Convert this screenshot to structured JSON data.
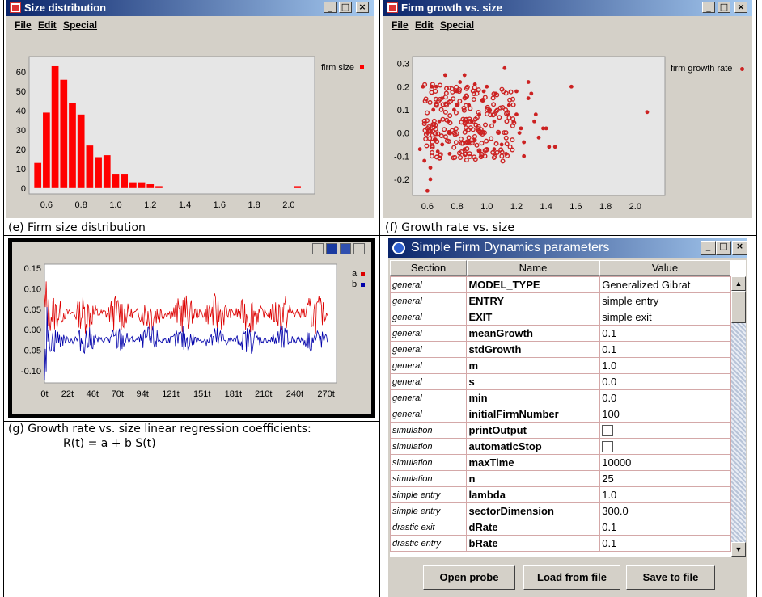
{
  "size_window": {
    "title": "Size distribution",
    "menu": [
      "File",
      "Edit",
      "Special"
    ],
    "legend": "firm size"
  },
  "growth_window": {
    "title": "Firm growth vs. size",
    "menu": [
      "File",
      "Edit",
      "Special"
    ],
    "legend": "firm growth rate"
  },
  "captions": {
    "e": "(e) Firm size distribution",
    "f": "(f) Growth rate vs. size",
    "g": "(g) Growth rate vs. size linear regression coefficients:",
    "g_formula": "R(t) = a + b S(t)"
  },
  "timeseries_legend": [
    "a",
    "b"
  ],
  "params_window": {
    "title": "Simple Firm Dynamics parameters",
    "headers": [
      "Section",
      "Name",
      "Value"
    ],
    "rows": [
      {
        "section": "general",
        "name": "MODEL_TYPE",
        "value": "Generalized Gibrat"
      },
      {
        "section": "general",
        "name": "ENTRY",
        "value": "simple entry"
      },
      {
        "section": "general",
        "name": "EXIT",
        "value": "simple exit"
      },
      {
        "section": "general",
        "name": "meanGrowth",
        "value": "0.1"
      },
      {
        "section": "general",
        "name": "stdGrowth",
        "value": "0.1"
      },
      {
        "section": "general",
        "name": "m",
        "value": "1.0"
      },
      {
        "section": "general",
        "name": "s",
        "value": "0.0"
      },
      {
        "section": "general",
        "name": "min",
        "value": "0.0"
      },
      {
        "section": "general",
        "name": "initialFirmNumber",
        "value": "100"
      },
      {
        "section": "simulation",
        "name": "printOutput",
        "value": ""
      },
      {
        "section": "simulation",
        "name": "automaticStop",
        "value": ""
      },
      {
        "section": "simulation",
        "name": "maxTime",
        "value": "10000"
      },
      {
        "section": "simulation",
        "name": "n",
        "value": "25"
      },
      {
        "section": "simple entry",
        "name": "lambda",
        "value": "1.0"
      },
      {
        "section": "simple entry",
        "name": "sectorDimension",
        "value": "300.0"
      },
      {
        "section": "drastic exit",
        "name": "dRate",
        "value": "0.1"
      },
      {
        "section": "drastic entry",
        "name": "bRate",
        "value": "0.1"
      }
    ],
    "buttons": [
      "Open probe",
      "Load from file",
      "Save to file"
    ]
  },
  "chart_data": [
    {
      "type": "bar",
      "x": [
        0.55,
        0.6,
        0.65,
        0.7,
        0.75,
        0.8,
        0.85,
        0.9,
        0.95,
        1.0,
        1.05,
        1.1,
        1.15,
        1.2,
        1.25,
        1.3,
        1.35,
        1.4,
        1.45,
        1.5,
        1.55,
        2.05
      ],
      "values": [
        13,
        39,
        63,
        56,
        44,
        38,
        22,
        16,
        17,
        7,
        7,
        3,
        3,
        2,
        1,
        0,
        0,
        0,
        0,
        0,
        0,
        1
      ],
      "xticks": [
        "0.6",
        "0.8",
        "1.0",
        "1.2",
        "1.4",
        "1.6",
        "1.8",
        "2.0"
      ],
      "yticks": [
        "0",
        "10",
        "20",
        "30",
        "40",
        "50",
        "60"
      ],
      "xlim": [
        0.5,
        2.15
      ],
      "ylim": [
        -3,
        68
      ],
      "legend": "firm size",
      "color": "#ff0000"
    },
    {
      "type": "scatter",
      "xticks": [
        "0.6",
        "0.8",
        "1.0",
        "1.2",
        "1.4",
        "1.6",
        "1.8",
        "2.0"
      ],
      "yticks": [
        "0.3",
        "0.2",
        "0.1",
        "0.0",
        "-0.1",
        "-0.2"
      ],
      "xlim": [
        0.5,
        2.2
      ],
      "ylim": [
        -0.27,
        0.33
      ],
      "legend": "firm growth rate",
      "color": "#cc2222",
      "points": [
        [
          0.6,
          -0.25
        ],
        [
          0.62,
          -0.2
        ],
        [
          0.58,
          -0.12
        ],
        [
          0.55,
          -0.07
        ],
        [
          0.63,
          0.2
        ],
        [
          0.57,
          0.2
        ],
        [
          0.66,
          0.2
        ],
        [
          0.7,
          0.15
        ],
        [
          0.72,
          0.25
        ],
        [
          0.68,
          0.05
        ],
        [
          0.7,
          -0.05
        ],
        [
          0.75,
          0.0
        ],
        [
          0.78,
          0.1
        ],
        [
          0.8,
          0.18
        ],
        [
          0.82,
          0.22
        ],
        [
          0.85,
          0.25
        ],
        [
          0.88,
          0.12
        ],
        [
          0.9,
          0.05
        ],
        [
          0.92,
          -0.03
        ],
        [
          0.95,
          0.08
        ],
        [
          0.98,
          0.18
        ],
        [
          1.0,
          0.2
        ],
        [
          1.02,
          0.1
        ],
        [
          1.05,
          0.05
        ],
        [
          1.08,
          0.0
        ],
        [
          1.1,
          -0.05
        ],
        [
          1.12,
          0.28
        ],
        [
          1.15,
          0.12
        ],
        [
          1.18,
          0.05
        ],
        [
          1.2,
          0.08
        ],
        [
          1.22,
          0.0
        ],
        [
          1.25,
          -0.04
        ],
        [
          1.28,
          0.15
        ],
        [
          1.3,
          0.17
        ],
        [
          1.32,
          0.05
        ],
        [
          1.35,
          -0.02
        ],
        [
          1.38,
          0.02
        ],
        [
          1.42,
          -0.06
        ],
        [
          1.46,
          -0.06
        ],
        [
          1.57,
          0.2
        ],
        [
          2.08,
          0.09
        ],
        [
          0.95,
          -0.08
        ],
        [
          1.05,
          -0.07
        ],
        [
          0.85,
          -0.07
        ],
        [
          0.75,
          -0.09
        ],
        [
          0.67,
          -0.08
        ],
        [
          1.28,
          0.22
        ],
        [
          1.4,
          0.02
        ],
        [
          1.33,
          0.08
        ],
        [
          1.2,
          0.18
        ],
        [
          1.06,
          0.17
        ],
        [
          0.92,
          0.21
        ],
        [
          0.8,
          0.12
        ],
        [
          0.74,
          0.05
        ],
        [
          0.64,
          0.1
        ],
        [
          0.6,
          0.0
        ],
        [
          0.62,
          -0.15
        ],
        [
          0.65,
          -0.03
        ],
        [
          0.97,
          0.14
        ],
        [
          1.13,
          -0.09
        ],
        [
          1.25,
          -0.1
        ],
        [
          1.23,
          0.02
        ],
        [
          0.88,
          -0.04
        ]
      ]
    },
    {
      "type": "line",
      "xticks": [
        "0t",
        "22t",
        "46t",
        "70t",
        "94t",
        "121t",
        "151t",
        "181t",
        "210t",
        "240t",
        "270t"
      ],
      "yticks": [
        "0.15",
        "0.10",
        "0.05",
        "0.00",
        "-0.05",
        "-0.10"
      ],
      "xlim": [
        0,
        280
      ],
      "ylim": [
        -0.13,
        0.16
      ],
      "series": [
        {
          "name": "a",
          "color": "#dd0000",
          "mean": 0.04,
          "amp": 0.05
        },
        {
          "name": "b",
          "color": "#0000aa",
          "mean": -0.025,
          "amp": 0.035
        }
      ]
    }
  ]
}
